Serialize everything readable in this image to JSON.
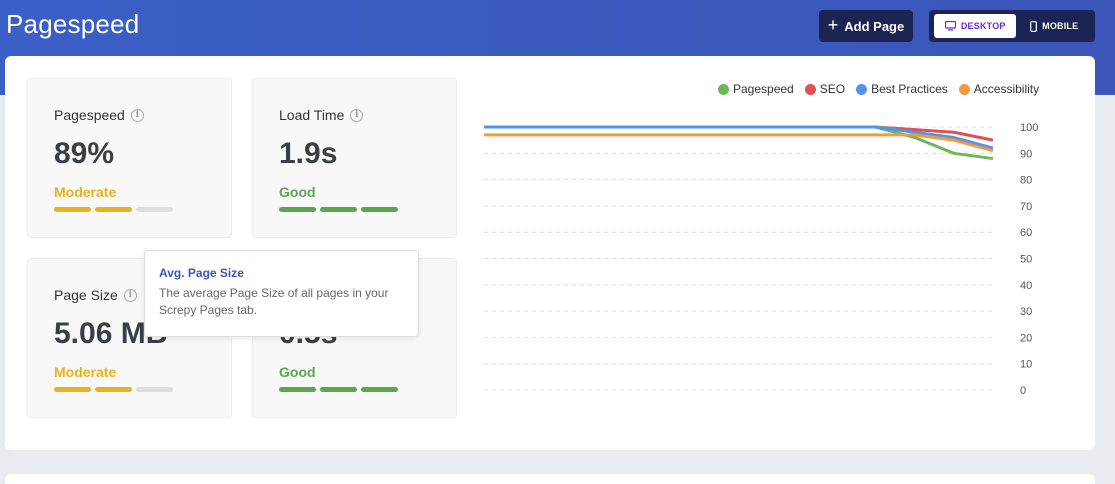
{
  "header": {
    "title": "Pagespeed",
    "add_page_label": "Add Page",
    "device_toggle": {
      "desktop_label": "DESKTOP",
      "mobile_label": "MOBILE",
      "selected": "DESKTOP"
    }
  },
  "cards": [
    {
      "label": "Pagespeed",
      "value": "89%",
      "status": "Moderate",
      "status_color": "#e9b21a",
      "filled_bars": 2,
      "total_bars": 3
    },
    {
      "label": "Load Time",
      "value": "1.9s",
      "status": "Good",
      "status_color": "#5ca64e",
      "filled_bars": 3,
      "total_bars": 3
    },
    {
      "label": "Page Size",
      "value": "5.06 MB",
      "status": "Moderate",
      "status_color": "#e9b21a",
      "filled_bars": 2,
      "total_bars": 3
    },
    {
      "label": "",
      "value": "0.5s",
      "status": "Good",
      "status_color": "#5ca64e",
      "filled_bars": 3,
      "total_bars": 3
    }
  ],
  "tooltip": {
    "title": "Avg. Page Size",
    "text": "The average Page Size of all pages in your Screpy Pages tab."
  },
  "chart_data": {
    "type": "line",
    "x": [
      0,
      1,
      2,
      3,
      4,
      5,
      6,
      7,
      8,
      9,
      10,
      11,
      12,
      13
    ],
    "series": [
      {
        "name": "Pagespeed",
        "color": "#6bb85a",
        "values": [
          100,
          100,
          100,
          100,
          100,
          100,
          100,
          100,
          100,
          100,
          100,
          96,
          90,
          88
        ]
      },
      {
        "name": "SEO",
        "color": "#e05252",
        "values": [
          100,
          100,
          100,
          100,
          100,
          100,
          100,
          100,
          100,
          100,
          100,
          99,
          98,
          95
        ]
      },
      {
        "name": "Best Practices",
        "color": "#4f96ea",
        "values": [
          100,
          100,
          100,
          100,
          100,
          100,
          100,
          100,
          100,
          100,
          100,
          98,
          96,
          92
        ]
      },
      {
        "name": "Accessibility",
        "color": "#f39a3e",
        "values": [
          97,
          97,
          97,
          97,
          97,
          97,
          97,
          97,
          97,
          97,
          97,
          97,
          95,
          91
        ]
      }
    ],
    "y_ticks": [
      "100",
      "90",
      "80",
      "70",
      "60",
      "50",
      "40",
      "30",
      "20",
      "10",
      "0"
    ],
    "ylim": [
      0,
      100
    ],
    "grid": true,
    "legend_position": "top-right"
  }
}
